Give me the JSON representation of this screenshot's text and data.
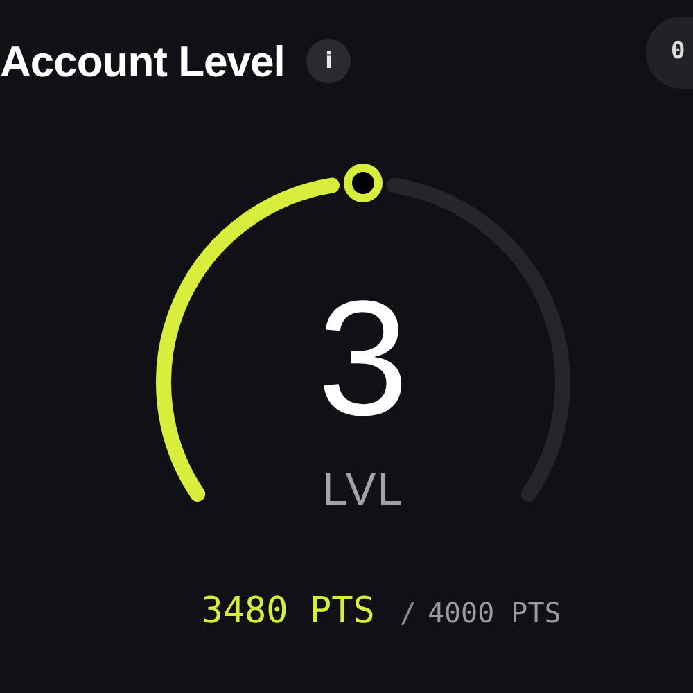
{
  "header": {
    "title": "Account Level",
    "info_icon": "i",
    "corner_badge": "0"
  },
  "gauge": {
    "value": "3",
    "unit": "LVL"
  },
  "points": {
    "current": "3480 PTS",
    "separator": "/",
    "target": "4000 PTS"
  }
}
